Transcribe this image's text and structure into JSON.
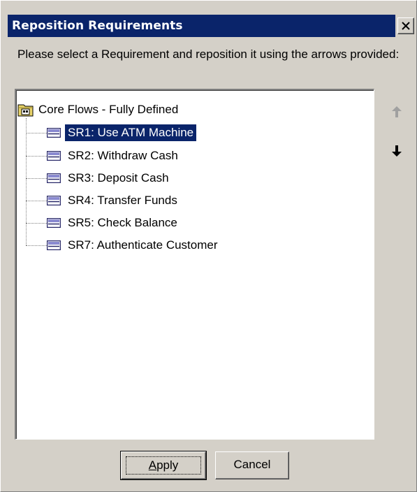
{
  "dialog": {
    "title": "Reposition Requirements",
    "close_icon": "close-icon",
    "prompt": "Please select a Requirement and reposition it using the arrows provided:"
  },
  "tree": {
    "root": {
      "label": "Core Flows - Fully Defined",
      "icon": "folder-icon"
    },
    "items": [
      {
        "label": "SR1: Use ATM Machine",
        "selected": true
      },
      {
        "label": "SR2: Withdraw Cash",
        "selected": false
      },
      {
        "label": "SR3: Deposit Cash",
        "selected": false
      },
      {
        "label": "SR4: Transfer Funds",
        "selected": false
      },
      {
        "label": "SR5: Check Balance",
        "selected": false
      },
      {
        "label": "SR7: Authenticate Customer",
        "selected": false
      }
    ]
  },
  "arrows": {
    "up_icon": "arrow-up-icon",
    "down_icon": "arrow-down-icon"
  },
  "buttons": {
    "apply_mnemonic": "A",
    "apply_rest": "pply",
    "cancel": "Cancel"
  },
  "colors": {
    "selection": "#0a246a",
    "dialog_bg": "#d4d0c8",
    "title_bar": "#0a246a"
  }
}
